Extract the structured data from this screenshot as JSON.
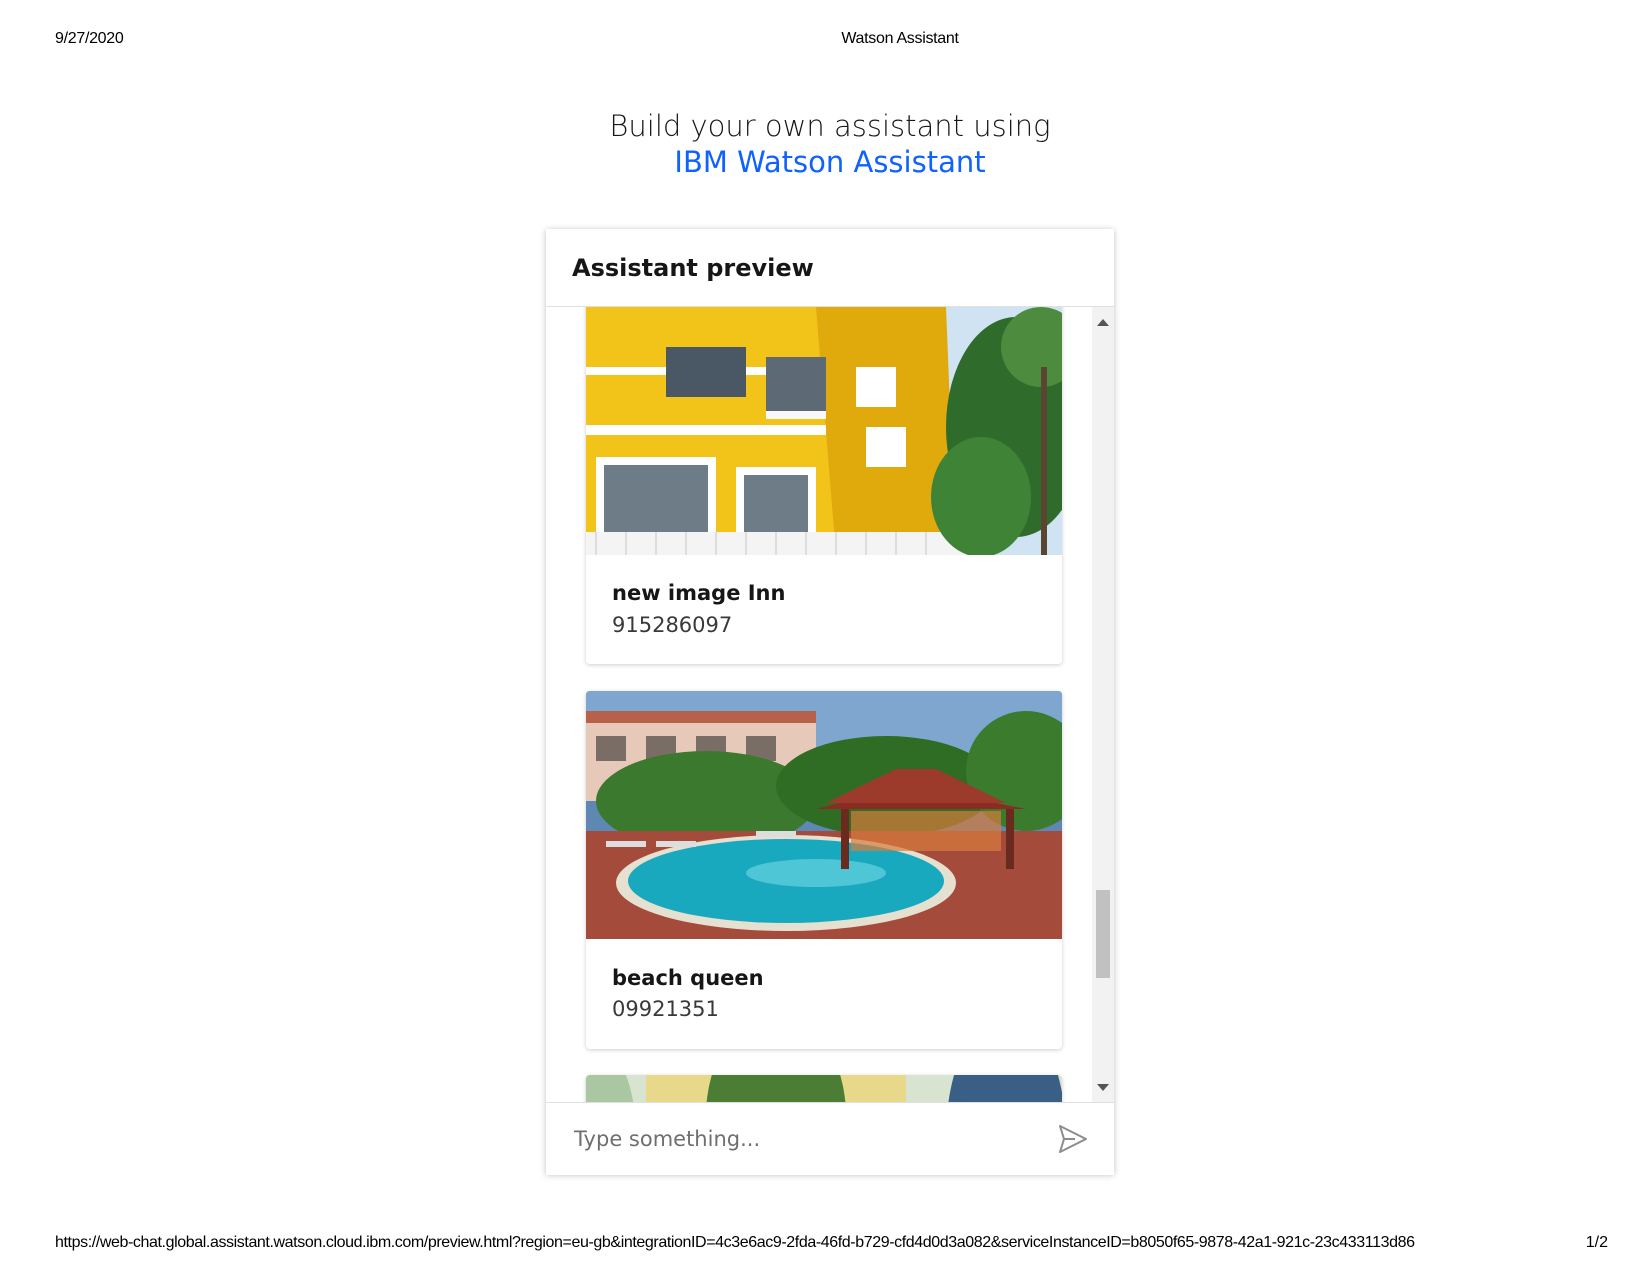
{
  "print": {
    "date": "9/27/2020",
    "title": "Watson Assistant",
    "url": "https://web-chat.global.assistant.watson.cloud.ibm.com/preview.html?region=eu-gb&integrationID=4c3e6ac9-2fda-46fd-b729-cfd4d0d3a082&serviceInstanceID=b8050f65-9878-42a1-921c-23c433113d86",
    "page": "1/2"
  },
  "hero": {
    "line1": "Build your own assistant using",
    "line2": "IBM Watson Assistant"
  },
  "widget": {
    "title": "Assistant preview",
    "cards": [
      {
        "name": "new image Inn",
        "phone": "915286097"
      },
      {
        "name": "beach queen",
        "phone": "09921351"
      }
    ],
    "input": {
      "placeholder": "Type something..."
    }
  },
  "colors": {
    "accent": "#0f62fe",
    "text": "#161616"
  },
  "icons": {
    "send": "send-icon",
    "scroll_up": "triangle-up-icon",
    "scroll_down": "triangle-down-icon"
  }
}
